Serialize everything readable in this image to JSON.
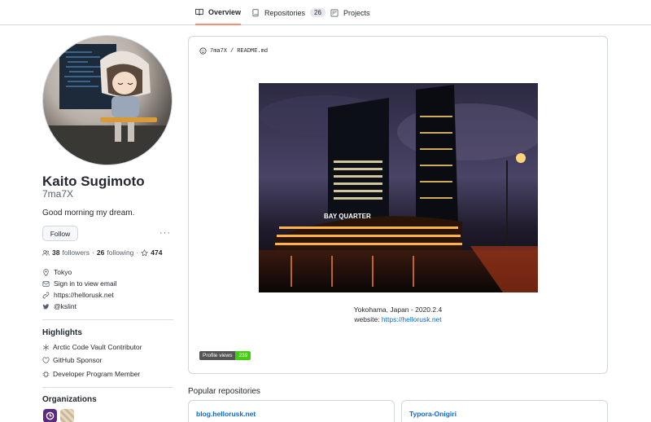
{
  "tabs": [
    {
      "label": "Overview",
      "active": true,
      "icon": "book-icon"
    },
    {
      "label": "Repositories",
      "count": "26",
      "icon": "repo-icon"
    },
    {
      "label": "Projects",
      "icon": "project-icon"
    }
  ],
  "profile": {
    "name": "Kaito Sugimoto",
    "login": "7ma7X",
    "bio": "Good morning my dream.",
    "follow_label": "Follow",
    "more_label": "···",
    "followers_count": "38",
    "followers_label": "followers",
    "separator": "·",
    "following_count": "26",
    "following_label": "following",
    "stars_count": "474",
    "location": "Tokyo",
    "email": "Sign in to view email",
    "website": "https://hellorusk.net",
    "twitter": "@kslint"
  },
  "highlights": {
    "title": "Highlights",
    "items": [
      "Arctic Code Vault Contributor",
      "GitHub Sponsor",
      "Developer Program Member"
    ]
  },
  "organizations": {
    "title": "Organizations"
  },
  "readme": {
    "owner": "7ma7X",
    "slash": "/",
    "file": "README.md",
    "photo_building_sign": "BAY QUARTER",
    "caption_line1": "Yokohama, Japan - 2020.2.4",
    "website_prefix": "website:",
    "website_link": "https://hellorusk.net",
    "badge_label": "Profile views",
    "badge_value": "239"
  },
  "popular": {
    "title": "Popular repositories",
    "repos": [
      "blog.hellorusk.net",
      "Typora-Onigiri"
    ]
  },
  "colors": {
    "accent_tab": "#fd8c73",
    "link": "#0969da",
    "badge_green": "#44cc11"
  }
}
